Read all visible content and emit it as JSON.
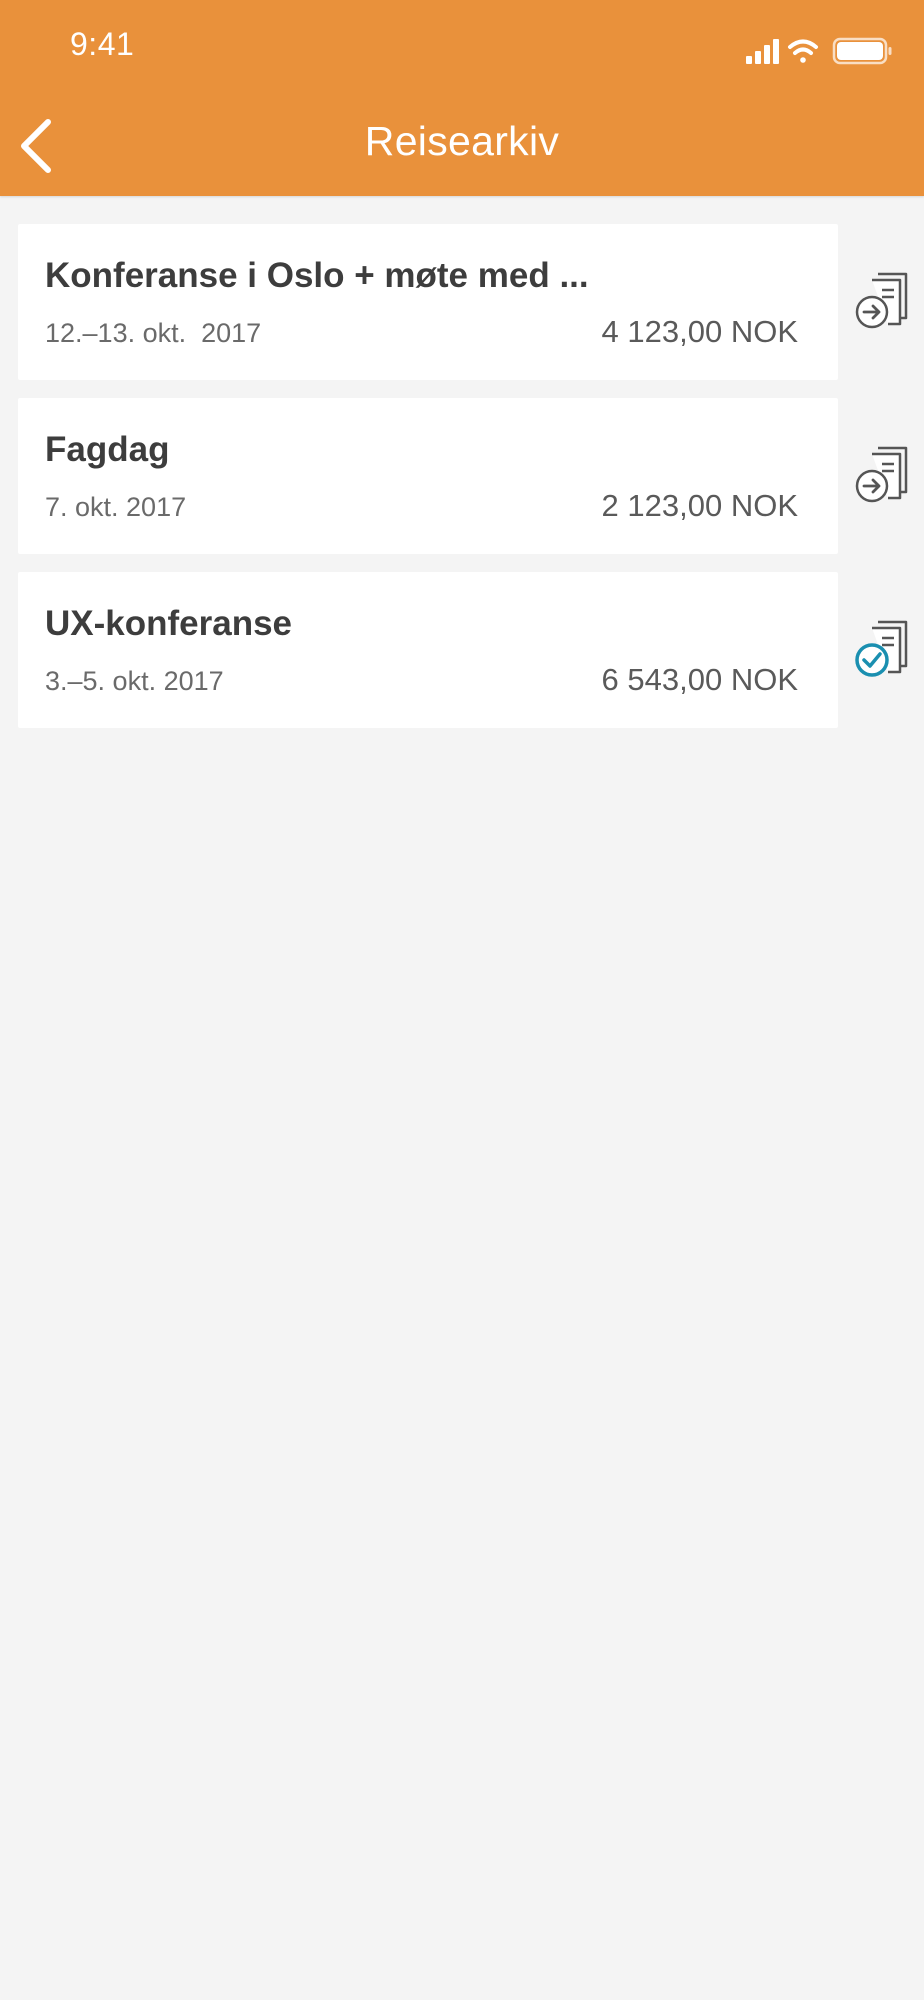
{
  "status_bar": {
    "time": "9:41",
    "icons": [
      "signal-icon",
      "wifi-icon",
      "battery-icon"
    ]
  },
  "header": {
    "title": "Reisearkiv",
    "back_icon": "chevron-left-icon"
  },
  "colors": {
    "header_bg": "#e9913b",
    "page_bg": "#f4f4f4",
    "card_bg": "#ffffff",
    "approved_accent": "#1a8fb0"
  },
  "trips": [
    {
      "title": "Konferanse i Oslo + møte med ...",
      "date": "12.–13. okt.  2017",
      "amount": "4 123,00 NOK",
      "status_icon": "document-submit-icon"
    },
    {
      "title": "Fagdag",
      "date": "7. okt. 2017",
      "amount": "2 123,00 NOK",
      "status_icon": "document-submit-icon"
    },
    {
      "title": "UX-konferanse",
      "date": "3.–5. okt. 2017",
      "amount": "6 543,00 NOK",
      "status_icon": "document-approved-icon"
    }
  ]
}
